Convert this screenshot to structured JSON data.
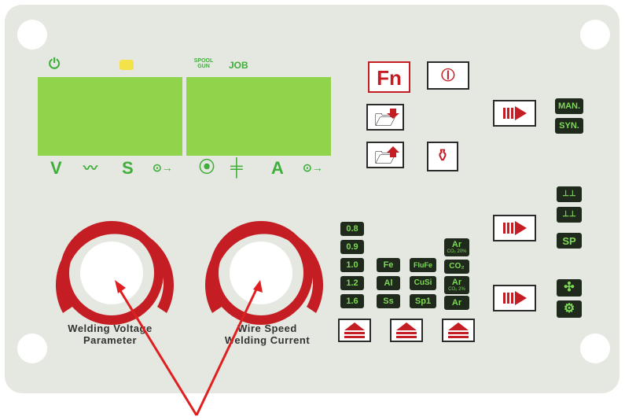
{
  "display": {
    "top_left_indicator": "power-icon",
    "top_middle_indicator": "warning-icon",
    "spool_gun_label": "SPOOL\nGUN",
    "job_label": "JOB",
    "bottom_left": [
      "V",
      "arc-icon",
      "S",
      "voltage-knob-icon"
    ],
    "bottom_right": [
      "wire-feed-icon",
      "inductance-icon",
      "A",
      "current-knob-icon"
    ],
    "lcd_color": "#8fd44a"
  },
  "buttons": {
    "fn_label": "Fn",
    "man_label": "MAN.",
    "syn_label": "SYN.",
    "sp_label": "SP"
  },
  "wire_diameters": [
    "0.8",
    "0.9",
    "1.0",
    "1.2",
    "1.6"
  ],
  "materials": [
    "Fe",
    "Al",
    "Ss"
  ],
  "flux_wires": [
    "FluFe",
    "CuSi",
    "Sp1"
  ],
  "gases": [
    {
      "main": "Ar",
      "sub": "CO₂ 20%"
    },
    {
      "main": "CO₂",
      "sub": ""
    },
    {
      "main": "Ar",
      "sub": "CO₂ 2%"
    },
    {
      "main": "Ar",
      "sub": ""
    }
  ],
  "knobs": {
    "left_label_line1": "Welding Voltage",
    "left_label_line2": "Parameter",
    "right_label_line1": "Wire Speed",
    "right_label_line2": "Welding Current"
  },
  "colors": {
    "panel": "#e5e8e0",
    "accent_red": "#c41e24",
    "lcd_green": "#8fd44a",
    "key_dark": "#1f2a1c",
    "key_text": "#7ed957"
  }
}
